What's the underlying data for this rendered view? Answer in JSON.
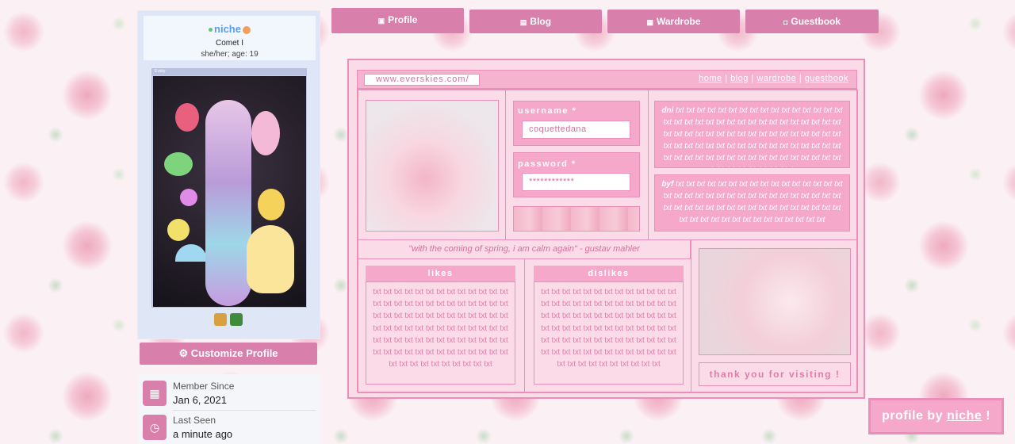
{
  "sidebar": {
    "username": "niche",
    "display_name": "Comet I",
    "pronouns": "she/her; age: 19",
    "avatar_bar_label": "Evsky",
    "customize_label": "Customize Profile",
    "member_since_label": "Member Since",
    "member_since_value": "Jan 6, 2021",
    "last_seen_label": "Last Seen",
    "last_seen_value": "a minute ago"
  },
  "tabs": [
    {
      "label": "Profile",
      "icon": "id-card-icon"
    },
    {
      "label": "Blog",
      "icon": "blog-icon"
    },
    {
      "label": "Wardrobe",
      "icon": "wardrobe-icon"
    },
    {
      "label": "Guestbook",
      "icon": "guestbook-icon"
    }
  ],
  "panel": {
    "url": "www.everskies.com/",
    "nav": {
      "home": "home",
      "sep": "|",
      "blog": "blog",
      "wardrobe": "wardrobe",
      "guestbook": "guestbook"
    },
    "username_label": "username *",
    "username_value": "coquettedana",
    "password_label": "password *",
    "password_value": "************",
    "dni_label": "dni",
    "dni_text": "txt txt txt txt txt txt txt txt txt txt txt txt txt txt txt txt txt txt txt txt txt txt txt txt txt txt txt txt txt txt txt txt txt txt txt txt txt txt txt txt txt txt txt txt txt txt txt txt txt txt txt txt txt txt txt txt txt txt txt txt txt txt txt txt txt txt txt txt txt txt txt txt txt txt txt txt txt txt txt txt txt txt txt txt txt txt txt txt txt txt txt txt",
    "byf_label": "byf",
    "byf_text": "txt txt txt txt txt txt txt txt txt txt txt txt txt txt txt txt txt txt txt txt txt txt txt txt txt txt txt txt txt txt txt txt txt txt txt txt txt txt txt txt txt txt txt txt txt txt txt txt txt txt txt txt txt txt txt txt txt txt txt txt txt txt txt txt",
    "quote": "\"with the coming of spring, i am calm again\" - gustav mahler",
    "likes_label": "likes",
    "likes_text": "txt txt txt txt txt txt txt txt txt txt txt txt txt txt txt txt txt txt txt txt txt txt txt txt txt txt txt txt txt txt txt txt txt txt txt txt txt txt txt txt txt txt txt txt txt txt txt txt txt txt txt txt txt txt txt txt txt txt txt txt txt txt txt txt txt txt txt txt txt txt txt txt txt txt txt txt txt txt txt txt txt txt txt txt txt txt txt txt",
    "dislikes_label": "dislikes",
    "dislikes_text": "txt txt txt txt txt txt txt txt txt txt txt txt txt txt txt txt txt txt txt txt txt txt txt txt txt txt txt txt txt txt txt txt txt txt txt txt txt txt txt txt txt txt txt txt txt txt txt txt txt txt txt txt txt txt txt txt txt txt txt txt txt txt txt txt txt txt txt txt txt txt txt txt txt txt txt txt txt txt txt txt txt txt txt txt txt txt txt txt",
    "thanks": "thank you for visiting !"
  },
  "credit": {
    "prefix": "profile by",
    "name": "niche",
    "suffix": "!"
  },
  "colors": {
    "accent": "#d87fab",
    "panel_border": "#e98fba",
    "panel_bg": "#fbdbe8",
    "pink_fill": "#f6a8cb"
  }
}
